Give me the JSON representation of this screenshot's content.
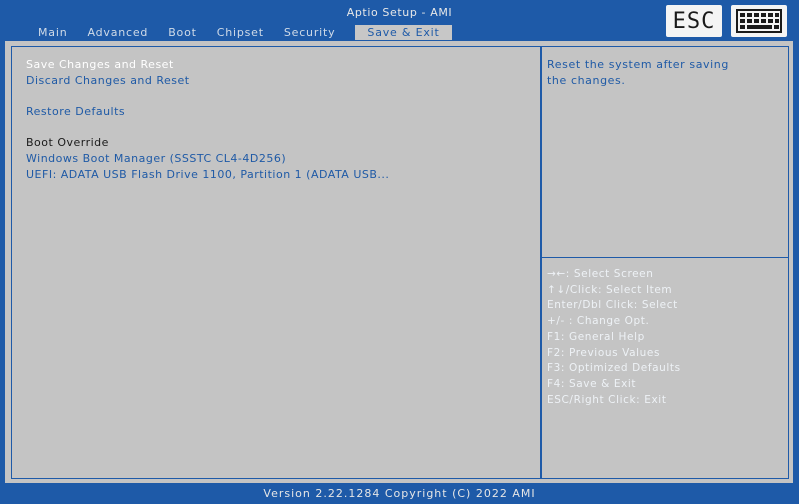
{
  "header": {
    "title": "Aptio Setup - AMI",
    "tabs": [
      {
        "label": "Main"
      },
      {
        "label": "Advanced"
      },
      {
        "label": "Boot"
      },
      {
        "label": "Chipset"
      },
      {
        "label": "Security"
      },
      {
        "label": "Save & Exit"
      }
    ],
    "active_tab": "Save & Exit",
    "esc_label": "ESC",
    "keyboard_icon": "keyboard-icon"
  },
  "menu": {
    "save_reset": "Save Changes and Reset",
    "discard_reset": "Discard Changes and Reset",
    "restore_defaults": "Restore Defaults",
    "boot_override_label": "Boot Override",
    "boot_options": [
      "Windows Boot Manager (SSSTC CL4-4D256)",
      "UEFI: ADATA USB Flash Drive 1100, Partition 1 (ADATA USB..."
    ]
  },
  "help": {
    "line1": "Reset the system after saving",
    "line2": "the changes."
  },
  "keys": [
    "→←: Select Screen",
    "↑↓/Click: Select Item",
    "Enter/Dbl Click: Select",
    "+/- : Change Opt.",
    "F1: General Help",
    "F2: Previous Values",
    "F3: Optimized Defaults",
    "F4: Save & Exit",
    "ESC/Right Click: Exit"
  ],
  "footer": "Version 2.22.1284 Copyright (C) 2022 AMI",
  "colors": {
    "frame_blue": "#1e5aa8",
    "panel_gray": "#c4c4c4",
    "item_blue": "#1f5aa6",
    "selected_white": "#ffffff"
  }
}
